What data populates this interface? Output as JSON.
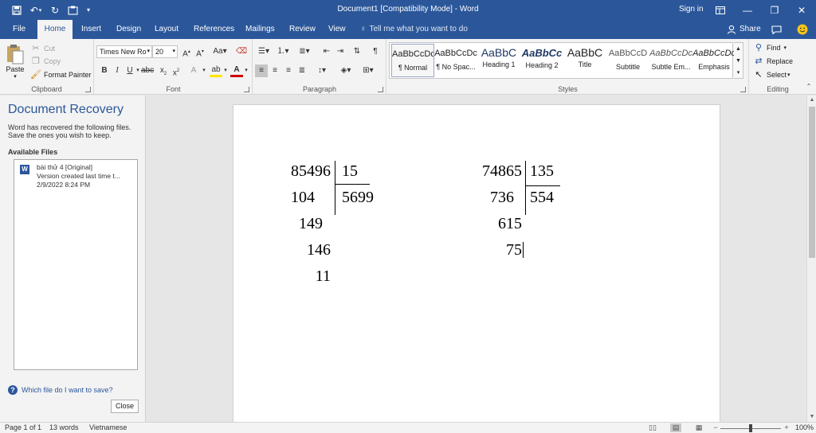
{
  "window": {
    "title": "Document1 [Compatibility Mode] - Word",
    "sign_in": "Sign in"
  },
  "tabs": [
    {
      "label": "File"
    },
    {
      "label": "Home"
    },
    {
      "label": "Insert"
    },
    {
      "label": "Design"
    },
    {
      "label": "Layout"
    },
    {
      "label": "References"
    },
    {
      "label": "Mailings"
    },
    {
      "label": "Review"
    },
    {
      "label": "View"
    }
  ],
  "active_tab": "Home",
  "tell_me": "Tell me what you want to do",
  "share": "Share",
  "ribbon": {
    "clipboard": {
      "label": "Clipboard",
      "paste": "Paste",
      "cut": "Cut",
      "copy": "Copy",
      "format_painter": "Format Painter"
    },
    "font": {
      "label": "Font",
      "font_name": "Times New Ro",
      "font_size": "20"
    },
    "paragraph": {
      "label": "Paragraph"
    },
    "styles": {
      "label": "Styles",
      "items": [
        {
          "preview": "AaBbCcDc",
          "name": "¶ Normal"
        },
        {
          "preview": "AaBbCcDc",
          "name": "¶ No Spac..."
        },
        {
          "preview": "AaBbC",
          "name": "Heading 1"
        },
        {
          "preview": "AaBbCc",
          "name": "Heading 2"
        },
        {
          "preview": "AaBbC",
          "name": "Title"
        },
        {
          "preview": "AaBbCcD",
          "name": "Subtitle"
        },
        {
          "preview": "AaBbCcDc",
          "name": "Subtle Em..."
        },
        {
          "preview": "AaBbCcDc",
          "name": "Emphasis"
        }
      ]
    },
    "editing": {
      "label": "Editing",
      "find": "Find",
      "replace": "Replace",
      "select": "Select"
    }
  },
  "recovery": {
    "heading": "Document Recovery",
    "message": "Word has recovered the following files. Save the ones you wish to keep.",
    "available_files": "Available Files",
    "file": {
      "name": "bài thử 4  [Original]",
      "detail": "Version created last time t...",
      "date": "2/9/2022 8:24 PM"
    },
    "help_link": "Which file do I want to save?",
    "close": "Close"
  },
  "document": {
    "left_division": {
      "dividend": "85496",
      "divisor": "15",
      "quotient": "5699",
      "steps": [
        "104",
        "149",
        "146",
        "11"
      ]
    },
    "right_division": {
      "dividend": "74865",
      "divisor": "135",
      "quotient": "554",
      "steps": [
        "736",
        "615",
        "75"
      ]
    }
  },
  "status": {
    "page": "Page 1 of 1",
    "words": "13 words",
    "language": "Vietnamese",
    "zoom": "100%",
    "zoom_percent": 100
  }
}
